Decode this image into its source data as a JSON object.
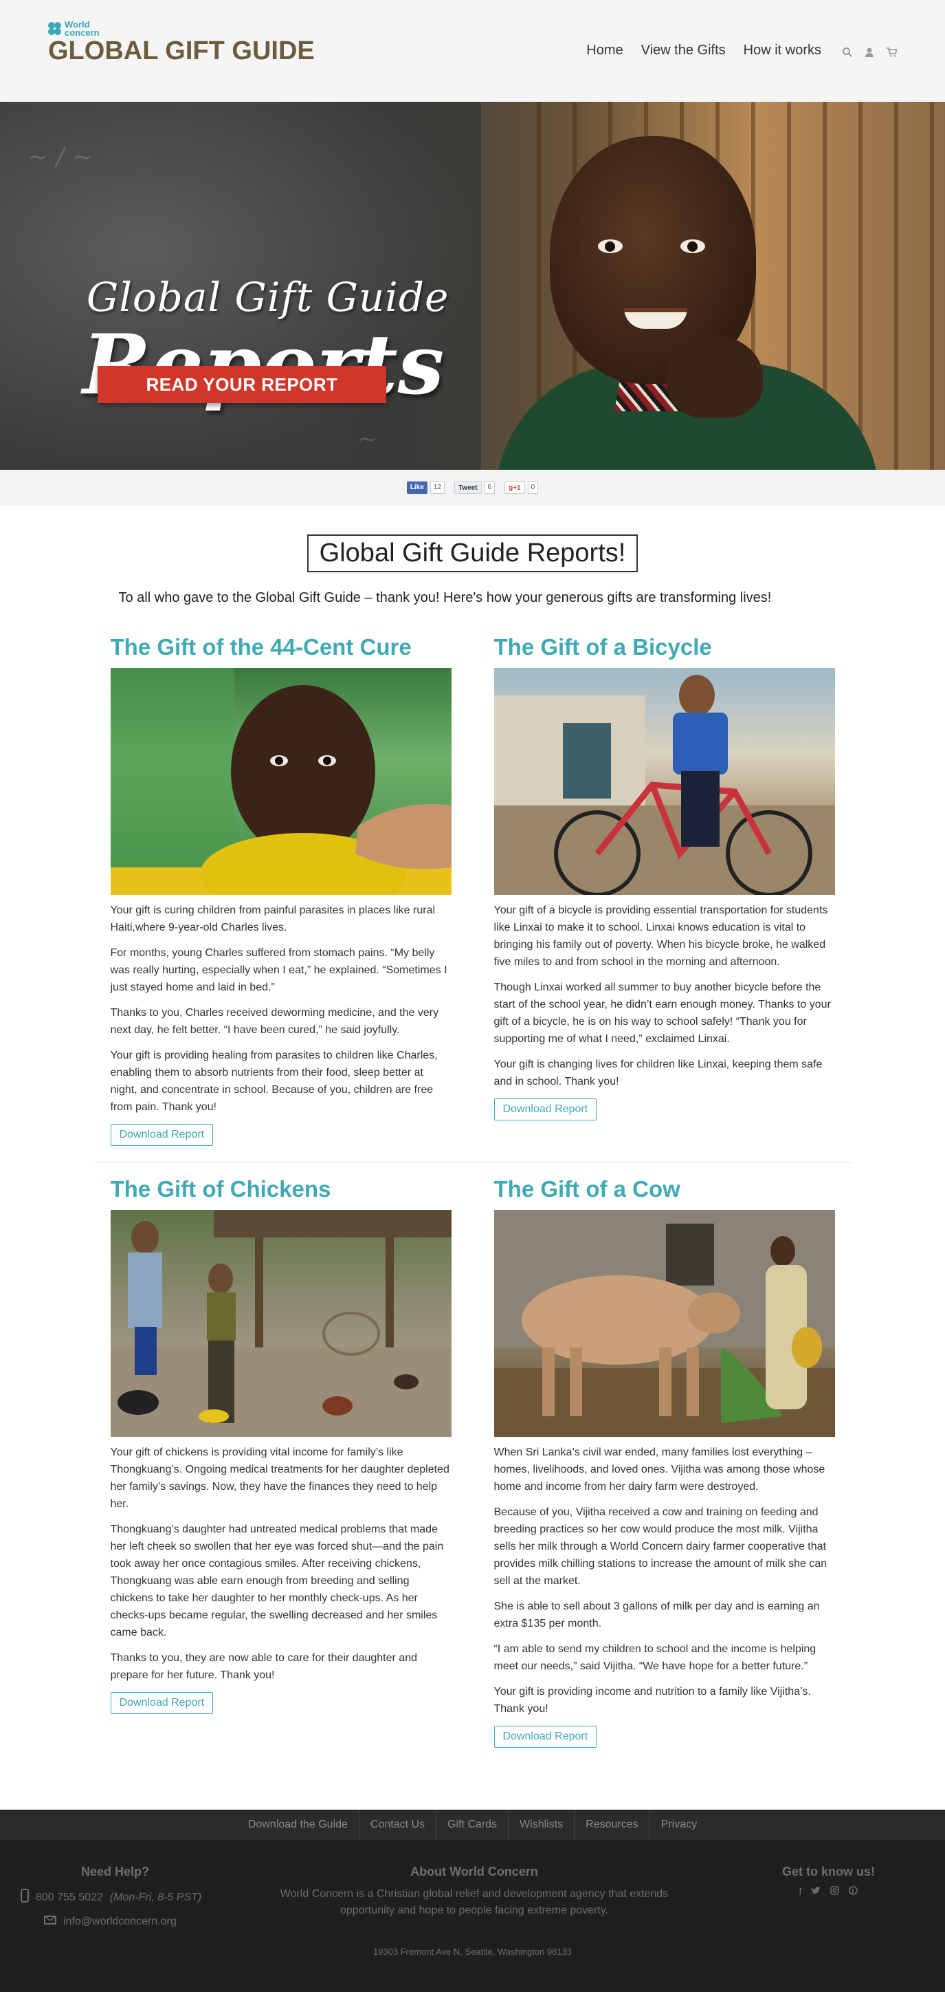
{
  "header": {
    "logo_small": "World\nconcern",
    "logo_small_line1": "World",
    "logo_small_line2": "concern",
    "logo_main": "GLOBAL GIFT GUIDE",
    "nav": [
      "Home",
      "View the Gifts",
      "How it works"
    ],
    "icons": [
      "search-icon",
      "user-icon",
      "cart-icon"
    ]
  },
  "hero": {
    "title_line1": "Global Gift Guide",
    "title_line2": "Reports",
    "button": "READ YOUR REPORT"
  },
  "share": {
    "fb_label": "Like",
    "fb_count": "12",
    "tw_label": "Tweet",
    "tw_count": "6",
    "gp_label": "g+1",
    "gp_count": "0"
  },
  "main": {
    "title": "Global Gift Guide Reports!",
    "intro": "To all who gave to the Global Gift Guide – thank you! Here's how your generous gifts are transforming lives!",
    "download_label": "Download Report",
    "gifts": [
      {
        "title": "The Gift of the 44-Cent Cure",
        "paragraphs": [
          "Your gift is curing children from painful parasites in places like rural Haiti,where 9-year-old Charles lives.",
          "For months, young Charles suffered from stomach pains. “My belly was really hurting, especially when I eat,” he explained. “Sometimes I just stayed home and laid in bed.”",
          "Thanks to you, Charles received deworming medicine, and the very next day, he felt better. “I have been cured,” he said joyfully.",
          "Your gift is providing healing from parasites to children like Charles, enabling them to absorb nutrients from their food, sleep better at night, and concentrate in school. Because of you, children are free from pain. Thank you!"
        ]
      },
      {
        "title": "The Gift of a Bicycle",
        "paragraphs": [
          "Your gift of a bicycle is providing essential transportation for students like Linxai to make it to school. Linxai knows education is vital to bringing his family out of poverty. When his bicycle broke, he walked five miles to and from school in the morning and afternoon.",
          "Though Linxai worked all summer to buy another bicycle before the start of the school year, he didn’t earn enough money. Thanks to your gift of a bicycle, he is on his way to school safely! “Thank you for supporting me of what I need,” exclaimed Linxai.",
          "Your gift is changing lives for children like Linxai, keeping them safe and in school. Thank you!"
        ]
      },
      {
        "title": "The Gift of Chickens",
        "paragraphs": [
          "Your gift of chickens is providing vital income for family’s like Thongkuang’s. Ongoing medical treatments for her daughter depleted her family’s savings. Now, they have the finances they need to help her.",
          "Thongkuang’s daughter had untreated medical problems that made her left cheek so swollen that her eye was forced shut—and the pain took away her once contagious smiles. After receiving chickens, Thongkuang was able earn enough from breeding and selling chickens to take her daughter to her monthly check-ups. As her checks-ups became regular, the swelling decreased and her smiles came back.",
          "Thanks to you, they are now able to care for their daughter and prepare for her future. Thank you!"
        ]
      },
      {
        "title": "The Gift of a Cow",
        "paragraphs": [
          "When Sri Lanka’s civil war ended, many families lost everything – homes, livelihoods, and loved ones. Vijitha was among those whose home and income from her dairy farm were destroyed.",
          "Because of you, Vijitha received a cow and training on feeding and breeding practices so her cow would produce the most milk. Vijitha sells her milk through a World Concern dairy farmer cooperative that provides milk chilling stations to increase the amount of milk she can sell at the market.",
          "She is able to sell about 3 gallons of milk per day and is earning an extra $135 per month.",
          "“I am able to send my children to school and the income is helping meet our needs,” said Vijitha. “We have hope for a better future.”",
          "Your gift is providing income and nutrition to a family like Vijitha’s. Thank you!"
        ]
      }
    ]
  },
  "footer": {
    "nav": [
      "Download the Guide",
      "Contact Us",
      "Gift Cards",
      "Wishlists",
      "Resources",
      "Privacy"
    ],
    "help_title": "Need Help?",
    "phone": "800 755 5022",
    "phone_hours": "(Mon-Fri, 8-5 PST)",
    "email": "info@worldconcern.org",
    "about_title": "About World Concern",
    "about_text": "World Concern is a Christian global relief and development agency that extends opportunity and hope to people facing extreme poverty.",
    "address": "19303 Fremont Ave N, Seattle, Washington 98133",
    "social_title": "Get to know us!",
    "social_icons": [
      "facebook-icon",
      "twitter-icon",
      "instagram-icon",
      "pinterest-icon"
    ]
  },
  "colors": {
    "accent": "#3fa9b5",
    "logo_brown": "#6e5a3c",
    "hero_button": "#d0372a",
    "footer_bg": "#1f1f1f"
  }
}
